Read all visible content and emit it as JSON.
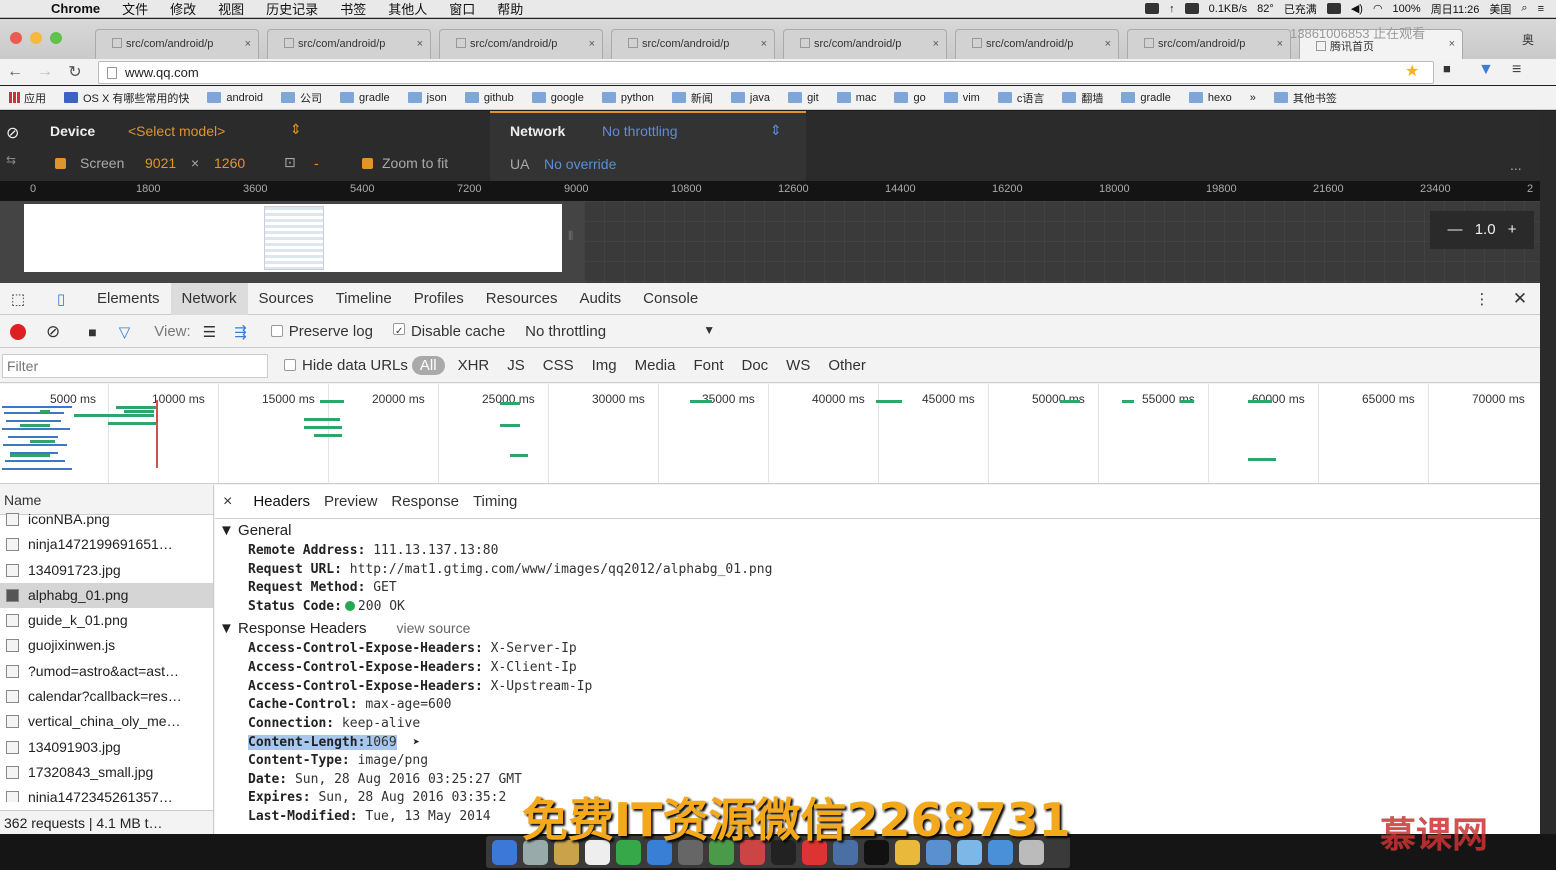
{
  "menubar": {
    "app": "Chrome",
    "items": [
      "文件",
      "修改",
      "视图",
      "历史记录",
      "书签",
      "其他人",
      "窗口",
      "帮助"
    ],
    "status": {
      "network": "0.1KB/s",
      "temp": "82°",
      "battery_text": "已充满",
      "battery_pct": "100%",
      "datetime": "周日11:26",
      "input_method": "美国"
    }
  },
  "window": {
    "tabs": [
      {
        "label": "src/com/android/p"
      },
      {
        "label": "src/com/android/p"
      },
      {
        "label": "src/com/android/p"
      },
      {
        "label": "src/com/android/p"
      },
      {
        "label": "src/com/android/p"
      },
      {
        "label": "src/com/android/p"
      },
      {
        "label": "src/com/android/p"
      },
      {
        "label": "腾讯首页"
      }
    ],
    "user": "13861006853 止在观看",
    "extra": "奥"
  },
  "toolbar": {
    "url": "www.qq.com"
  },
  "bookmarks": {
    "apps": "应用",
    "items": [
      "OS X 有哪些常用的快",
      "android",
      "公司",
      "gradle",
      "json",
      "github",
      "google",
      "python",
      "新闻",
      "java",
      "git",
      "mac",
      "go",
      "vim",
      "c语言",
      "翻墙",
      "gradle",
      "hexo"
    ],
    "more": "»",
    "other": "其他书签"
  },
  "device": {
    "device_label": "Device",
    "model": "<Select model>",
    "screen_label": "Screen",
    "screen_w": "9021",
    "times": "×",
    "screen_h": "1260",
    "zoom_to_fit": "Zoom to fit",
    "network_label": "Network",
    "throttling": "No throttling",
    "ua_label": "UA",
    "ua_value": "No override",
    "more": "..."
  },
  "ruler": {
    "ticks": [
      "0",
      "1800",
      "3600",
      "5400",
      "7200",
      "9000",
      "10800",
      "12600",
      "14400",
      "16200",
      "18000",
      "19800",
      "21600",
      "23400",
      "2"
    ]
  },
  "zoom": {
    "minus": "—",
    "value": "1.0",
    "plus": "+"
  },
  "devtools": {
    "tabs": [
      "Elements",
      "Network",
      "Sources",
      "Timeline",
      "Profiles",
      "Resources",
      "Audits",
      "Console"
    ],
    "active_tab": "Network",
    "controls": {
      "view": "View:",
      "preserve_log": "Preserve log",
      "disable_cache": "Disable cache",
      "throttling": "No throttling"
    },
    "filter": {
      "placeholder": "Filter",
      "hide_data_urls": "Hide data URLs",
      "types": [
        "All",
        "XHR",
        "JS",
        "CSS",
        "Img",
        "Media",
        "Font",
        "Doc",
        "WS",
        "Other"
      ]
    },
    "overview_ticks": [
      "5000 ms",
      "10000 ms",
      "15000 ms",
      "20000 ms",
      "25000 ms",
      "30000 ms",
      "35000 ms",
      "40000 ms",
      "45000 ms",
      "50000 ms",
      "55000 ms",
      "60000 ms",
      "65000 ms",
      "70000 ms"
    ],
    "requests": {
      "header": "Name",
      "rows": [
        "iconNBA.png",
        "ninja1472199691651…",
        "134091723.jpg",
        "alphabg_01.png",
        "guide_k_01.png",
        "guojixinwen.js",
        "?umod=astro&act=ast…",
        "calendar?callback=res…",
        "vertical_china_oly_me…",
        "134091903.jpg",
        "17320843_small.jpg",
        "ninja1472345261357…"
      ],
      "selected": "alphabg_01.png",
      "summary": "362 requests  |  4.1 MB t…"
    },
    "details": {
      "close": "×",
      "tabs": [
        "Headers",
        "Preview",
        "Response",
        "Timing"
      ],
      "general_title": "General",
      "general": [
        {
          "k": "Remote Address:",
          "v": "111.13.137.13:80"
        },
        {
          "k": "Request URL:",
          "v": "http://mat1.gtimg.com/www/images/qq2012/alphabg_01.png"
        },
        {
          "k": "Request Method:",
          "v": "GET"
        },
        {
          "k": "Status Code:",
          "v": "200 OK"
        }
      ],
      "response_title": "Response Headers",
      "view_source": "view source",
      "response": [
        {
          "k": "Access-Control-Expose-Headers:",
          "v": "X-Server-Ip"
        },
        {
          "k": "Access-Control-Expose-Headers:",
          "v": "X-Client-Ip"
        },
        {
          "k": "Access-Control-Expose-Headers:",
          "v": "X-Upstream-Ip"
        },
        {
          "k": "Cache-Control:",
          "v": "max-age=600"
        },
        {
          "k": "Connection:",
          "v": "keep-alive"
        },
        {
          "k": "Content-Length:",
          "v": "1069"
        },
        {
          "k": "Content-Type:",
          "v": "image/png"
        },
        {
          "k": "Date:",
          "v": "Sun, 28 Aug 2016 03:25:27 GMT"
        },
        {
          "k": "Expires:",
          "v": "Sun, 28 Aug 2016 03:35:2"
        },
        {
          "k": "Last-Modified:",
          "v": "Tue, 13 May 2014"
        }
      ],
      "highlighted": "Content-Length:"
    }
  },
  "overlay": {
    "watermark": "免费IT资源微信2268731",
    "logo": "慕课网"
  },
  "colors": {
    "accent_orange": "#e0942c",
    "link_blue": "#5b8fd8",
    "waterfall_green": "#2fa56a",
    "status_green": "#26a552",
    "record_red": "#e02020"
  }
}
